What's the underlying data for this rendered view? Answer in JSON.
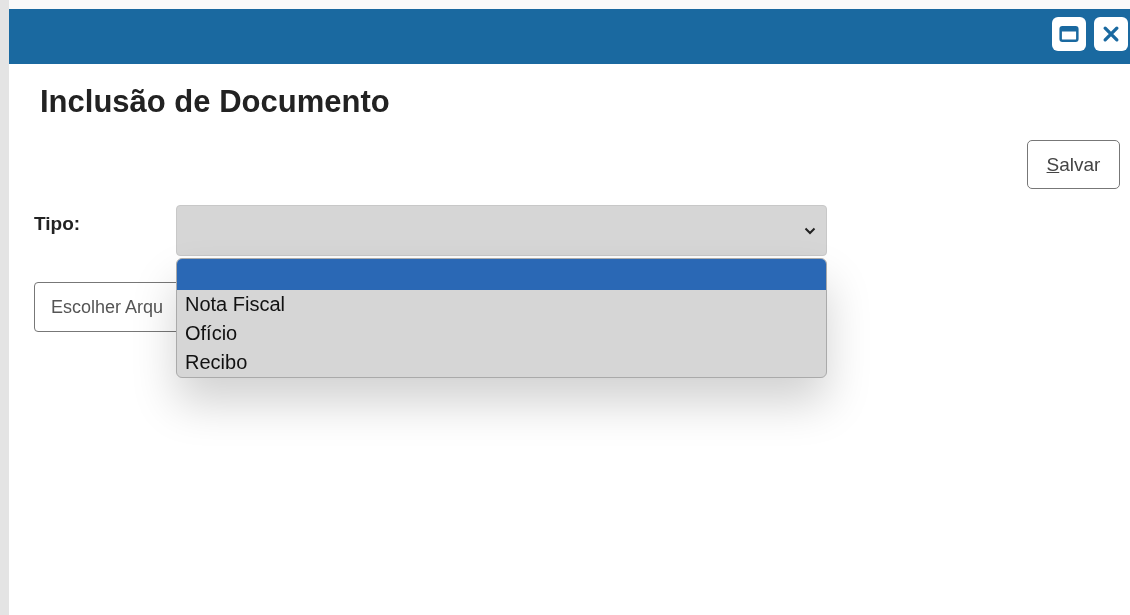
{
  "title_bar": {
    "buttons": [
      {
        "kind": "maximize"
      },
      {
        "kind": "close"
      }
    ]
  },
  "title": "Inclusão de Documento",
  "save_button": {
    "label": "Salvar",
    "underline_first": true
  },
  "tipo": {
    "label": "Tipo:",
    "expanded": true,
    "options": [
      {
        "selected": true
      },
      {
        "label": "Nota Fiscal",
        "selected": false
      },
      {
        "label": "Ofício",
        "selected": false
      },
      {
        "label": "Recibo",
        "selected": false
      }
    ]
  },
  "file_button": {
    "label": "Escolher Arqu"
  }
}
